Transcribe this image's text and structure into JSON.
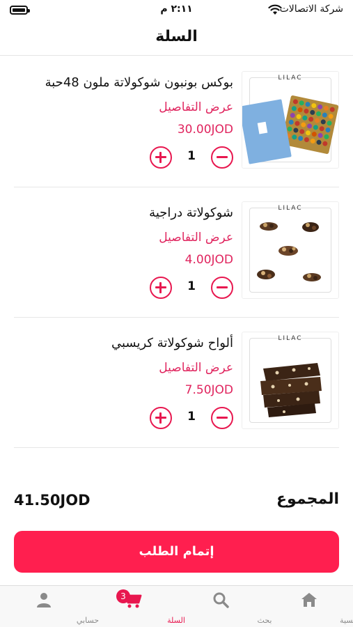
{
  "status_bar": {
    "carrier": "شركة الاتصالات",
    "time": "٢:١١ م"
  },
  "header": {
    "title": "السلة"
  },
  "cart": {
    "brand": "LILAC",
    "items": [
      {
        "name": "بوكس بونبون شوكولاتة ملون 48حبة",
        "details_link": "عرض التفاصيل",
        "price": "30.00JOD",
        "quantity": "1"
      },
      {
        "name": "شوكولاتة دراجية",
        "details_link": "عرض التفاصيل",
        "price": "4.00JOD",
        "quantity": "1"
      },
      {
        "name": "ألواح شوكولاتة كريسبي",
        "details_link": "عرض التفاصيل",
        "price": "7.50JOD",
        "quantity": "1"
      }
    ]
  },
  "summary": {
    "total_label": "المجموع",
    "total_value": "41.50JOD"
  },
  "checkout": {
    "label": "إتمام الطلب"
  },
  "tabbar": {
    "tabs": [
      {
        "label": "الرئيسية",
        "icon": "home-icon"
      },
      {
        "label": "بحث",
        "icon": "search-icon"
      },
      {
        "label": "السلة",
        "icon": "cart-icon",
        "badge": "3",
        "active": true
      },
      {
        "label": "حسابي",
        "icon": "user-icon"
      }
    ]
  },
  "colors": {
    "accent": "#e8174f",
    "checkout": "#ff1f4f"
  }
}
